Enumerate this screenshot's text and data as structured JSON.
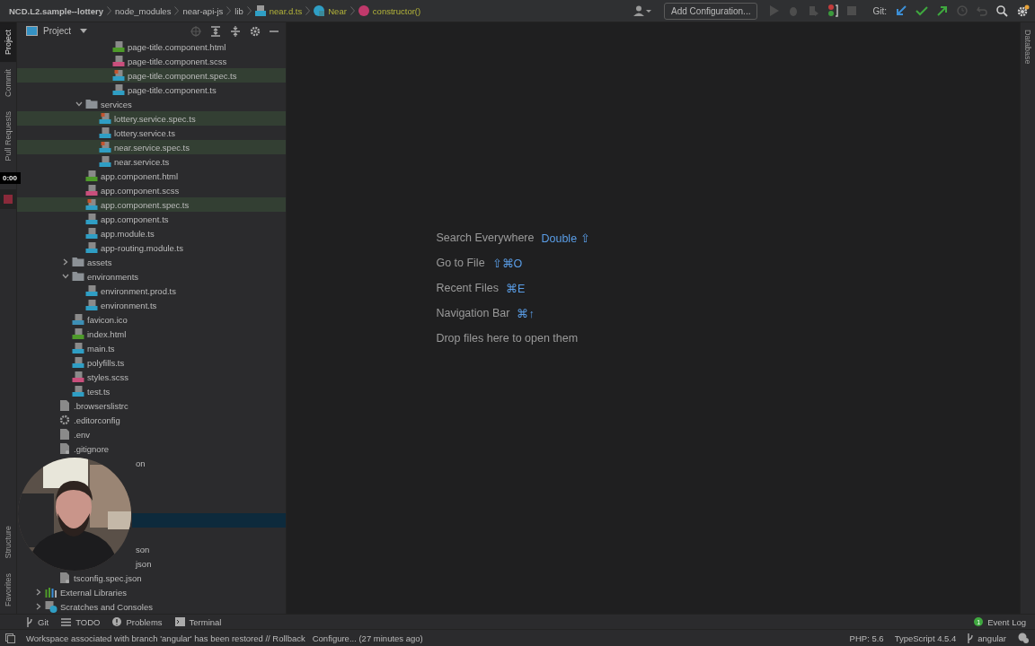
{
  "breadcrumbs": [
    {
      "label": "NCD.L2.sample--lottery",
      "kind": "project"
    },
    {
      "label": "node_modules",
      "kind": "dir"
    },
    {
      "label": "near-api-js",
      "kind": "dir"
    },
    {
      "label": "lib",
      "kind": "dir"
    },
    {
      "label": "near.d.ts",
      "kind": "file"
    },
    {
      "label": "Near",
      "kind": "class"
    },
    {
      "label": "constructor()",
      "kind": "method"
    }
  ],
  "toolbar": {
    "run_config": "Add Configuration...",
    "git_label": "Git:"
  },
  "left_strip_top": [
    {
      "label": "Project",
      "selected": true
    },
    {
      "label": "Commit",
      "selected": false
    },
    {
      "label": "Pull Requests",
      "selected": false
    }
  ],
  "recorder": {
    "timer": "0:00"
  },
  "left_strip_bottom": [
    {
      "label": "Structure",
      "selected": false
    },
    {
      "label": "Favorites",
      "selected": false
    }
  ],
  "project_panel": {
    "title": "Project",
    "tree": [
      {
        "kind": "continued",
        "children": [
          {
            "kind": "continued",
            "children": [
              {
                "kind": "continued",
                "children": [
                  {
                    "kind": "continued",
                    "children": [
                      {
                        "kind": "continued",
                        "children": [
                          {
                            "label": "page-title.component.html",
                            "kind": "html",
                            "highlighted": false,
                            "selected": false
                          },
                          {
                            "label": "page-title.component.scss",
                            "kind": "scss",
                            "highlighted": false,
                            "selected": false
                          },
                          {
                            "label": "page-title.component.spec.ts",
                            "kind": "spec",
                            "highlighted": true,
                            "selected": false
                          },
                          {
                            "label": "page-title.component.ts",
                            "kind": "ts",
                            "highlighted": false,
                            "selected": false
                          }
                        ]
                      }
                    ]
                  },
                  {
                    "label": "services",
                    "kind": "folder",
                    "expanded": true,
                    "highlighted": false,
                    "selected": false,
                    "children": [
                      {
                        "label": "lottery.service.spec.ts",
                        "kind": "spec",
                        "highlighted": true,
                        "selected": false
                      },
                      {
                        "label": "lottery.service.ts",
                        "kind": "ts",
                        "highlighted": false,
                        "selected": false
                      },
                      {
                        "label": "near.service.spec.ts",
                        "kind": "spec",
                        "highlighted": true,
                        "selected": false
                      },
                      {
                        "label": "near.service.ts",
                        "kind": "ts",
                        "highlighted": false,
                        "selected": false
                      }
                    ]
                  },
                  {
                    "label": "app.component.html",
                    "kind": "html",
                    "highlighted": false,
                    "selected": false
                  },
                  {
                    "label": "app.component.scss",
                    "kind": "scss",
                    "highlighted": false,
                    "selected": false
                  },
                  {
                    "label": "app.component.spec.ts",
                    "kind": "spec",
                    "highlighted": true,
                    "selected": false
                  },
                  {
                    "label": "app.component.ts",
                    "kind": "ts",
                    "highlighted": false,
                    "selected": false
                  },
                  {
                    "label": "app.module.ts",
                    "kind": "ts",
                    "highlighted": false,
                    "selected": false
                  },
                  {
                    "label": "app-routing.module.ts",
                    "kind": "ts",
                    "highlighted": false,
                    "selected": false
                  }
                ]
              },
              {
                "label": "assets",
                "kind": "folder",
                "expanded": false,
                "highlighted": false,
                "selected": false
              },
              {
                "label": "environments",
                "kind": "folder",
                "expanded": true,
                "highlighted": false,
                "selected": false,
                "children": [
                  {
                    "label": "environment.prod.ts",
                    "kind": "ts",
                    "highlighted": false,
                    "selected": false
                  },
                  {
                    "label": "environment.ts",
                    "kind": "ts",
                    "highlighted": false,
                    "selected": false
                  }
                ]
              },
              {
                "label": "favicon.ico",
                "kind": "ico",
                "highlighted": false,
                "selected": false
              },
              {
                "label": "index.html",
                "kind": "html",
                "highlighted": false,
                "selected": false
              },
              {
                "label": "main.ts",
                "kind": "ts",
                "highlighted": false,
                "selected": false
              },
              {
                "label": "polyfills.ts",
                "kind": "ts",
                "highlighted": false,
                "selected": false
              },
              {
                "label": "styles.scss",
                "kind": "scss",
                "highlighted": false,
                "selected": false
              },
              {
                "label": "test.ts",
                "kind": "ts",
                "highlighted": false,
                "selected": false
              }
            ]
          },
          {
            "label": ".browserslistrc",
            "kind": "file",
            "highlighted": false,
            "selected": false
          },
          {
            "label": ".editorconfig",
            "kind": "gear",
            "highlighted": false,
            "selected": false
          },
          {
            "label": ".env",
            "kind": "file",
            "highlighted": false,
            "selected": false
          },
          {
            "label": ".gitignore",
            "kind": "ignore",
            "highlighted": false,
            "selected": false
          },
          {
            "kind": "partial",
            "label": "on",
            "highlighted": false,
            "selected": false
          },
          {
            "kind": "covered",
            "highlighted": false,
            "selected": false
          },
          {
            "kind": "covered",
            "highlighted": false,
            "selected": false
          },
          {
            "kind": "covered",
            "highlighted": false,
            "selected": false
          },
          {
            "kind": "covered",
            "highlighted": false,
            "selected": true
          },
          {
            "kind": "covered",
            "highlighted": false,
            "selected": false
          },
          {
            "kind": "partial",
            "label": "son",
            "highlighted": false,
            "selected": false
          },
          {
            "kind": "partial",
            "label": "json",
            "highlighted": false,
            "selected": false
          },
          {
            "label": "tsconfig.spec.json",
            "kind": "json",
            "highlighted": false,
            "selected": false
          }
        ]
      },
      {
        "label": "External Libraries",
        "kind": "libs",
        "expanded": false,
        "highlighted": false,
        "selected": false
      },
      {
        "label": "Scratches and Consoles",
        "kind": "scratch",
        "expanded": false,
        "highlighted": false,
        "selected": false
      }
    ]
  },
  "editor_hints": [
    {
      "label": "Search Everywhere",
      "shortcut": "Double ⇧"
    },
    {
      "label": "Go to File",
      "shortcut": "⇧⌘O"
    },
    {
      "label": "Recent Files",
      "shortcut": "⌘E"
    },
    {
      "label": "Navigation Bar",
      "shortcut": "⌘↑"
    },
    {
      "label": "Drop files here to open them"
    }
  ],
  "right_strip": [
    {
      "label": "Database",
      "selected": false
    }
  ],
  "tool_windows": [
    {
      "label": "Git",
      "kind": "git"
    },
    {
      "label": "TODO",
      "kind": "todo"
    },
    {
      "label": "Problems",
      "kind": "problems"
    },
    {
      "label": "Terminal",
      "kind": "terminal"
    }
  ],
  "event_log": {
    "label": "Event Log",
    "count": "1"
  },
  "status_bar": {
    "message": "Workspace associated with branch 'angular' has been restored // Rollback   Configure... (27 minutes ago)",
    "php": "PHP: 5.6",
    "typescript": "TypeScript 4.5.4",
    "branch": "angular"
  }
}
